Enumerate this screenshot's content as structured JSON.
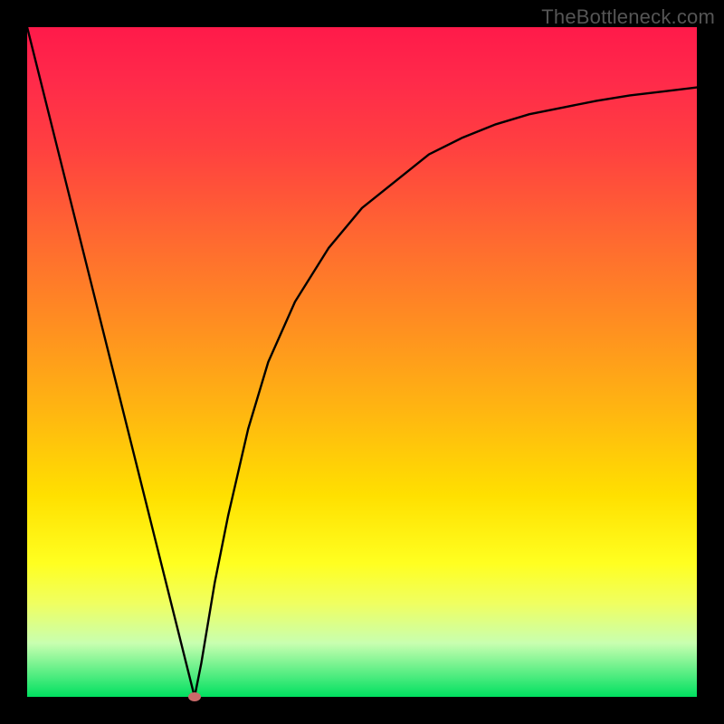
{
  "watermark": "TheBottleneck.com",
  "chart_data": {
    "type": "line",
    "title": "",
    "xlabel": "",
    "ylabel": "",
    "xlim": [
      0,
      100
    ],
    "ylim": [
      0,
      100
    ],
    "x": [
      0,
      5,
      10,
      15,
      20,
      22,
      24,
      25,
      26,
      28,
      30,
      33,
      36,
      40,
      45,
      50,
      55,
      60,
      65,
      70,
      75,
      80,
      85,
      90,
      95,
      100
    ],
    "series": [
      {
        "name": "bottleneck-curve",
        "values": [
          100,
          80,
          60,
          40,
          20,
          12,
          4,
          0,
          5,
          17,
          27,
          40,
          50,
          59,
          67,
          73,
          77,
          81,
          83.5,
          85.5,
          87,
          88,
          89,
          89.8,
          90.4,
          91
        ]
      }
    ],
    "marker": {
      "x": 25,
      "y": 0
    },
    "background_gradient": {
      "top": "#ff1a4a",
      "mid": "#ffe000",
      "bottom": "#00e060"
    }
  }
}
